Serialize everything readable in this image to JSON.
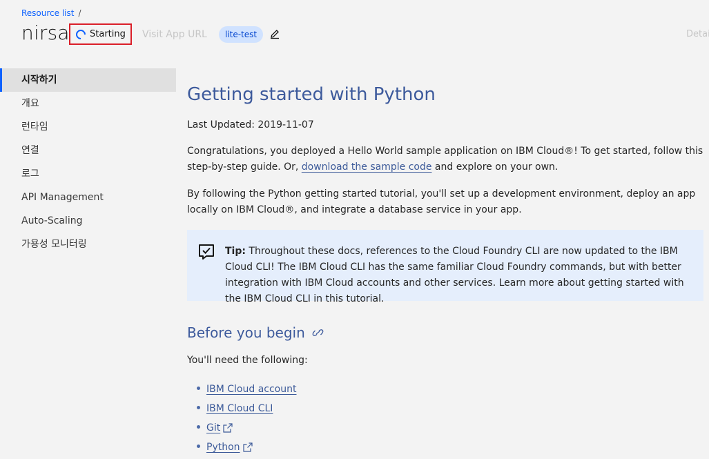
{
  "header": {
    "breadcrumb_link": "Resource list",
    "breadcrumb_sep": "/",
    "app_name": "nirsa",
    "status": "Starting",
    "visit_url": "Visit App URL",
    "tag": "lite-test",
    "details": "Details"
  },
  "sidebar": {
    "items": [
      {
        "label": "시작하기"
      },
      {
        "label": "개요"
      },
      {
        "label": "런타임"
      },
      {
        "label": "연결"
      },
      {
        "label": "로그"
      },
      {
        "label": "API Management"
      },
      {
        "label": "Auto-Scaling"
      },
      {
        "label": "가용성 모니터링"
      }
    ]
  },
  "main": {
    "title": "Getting started with Python",
    "updated": "Last Updated: 2019-11-07",
    "para1_a": "Congratulations, you deployed a Hello World sample application on IBM Cloud®! To get started, follow this step-by-step guide. Or, ",
    "para1_link": "download the sample code",
    "para1_b": " and explore on your own.",
    "para2": "By following the Python getting started tutorial, you'll set up a development environment, deploy an app locally on IBM Cloud®, and integrate a database service in your app.",
    "tip_label": "Tip:",
    "tip_text": " Throughout these docs, references to the Cloud Foundry CLI are now updated to the IBM Cloud CLI! The IBM Cloud CLI has the same familiar Cloud Foundry commands, but with better integration with IBM Cloud accounts and other services. Learn more about getting started with the IBM Cloud CLI in this tutorial.",
    "section_title": "Before you begin",
    "need_text": "You'll need the following:",
    "requirements": [
      {
        "label": "IBM Cloud account"
      },
      {
        "label": "IBM Cloud CLI"
      },
      {
        "label": "Git"
      },
      {
        "label": "Python"
      }
    ]
  },
  "colors": {
    "accent": "#0f62fe",
    "highlight_border": "#da1e28",
    "heading": "#3d5a9c",
    "tip_bg": "#e5eefc"
  }
}
